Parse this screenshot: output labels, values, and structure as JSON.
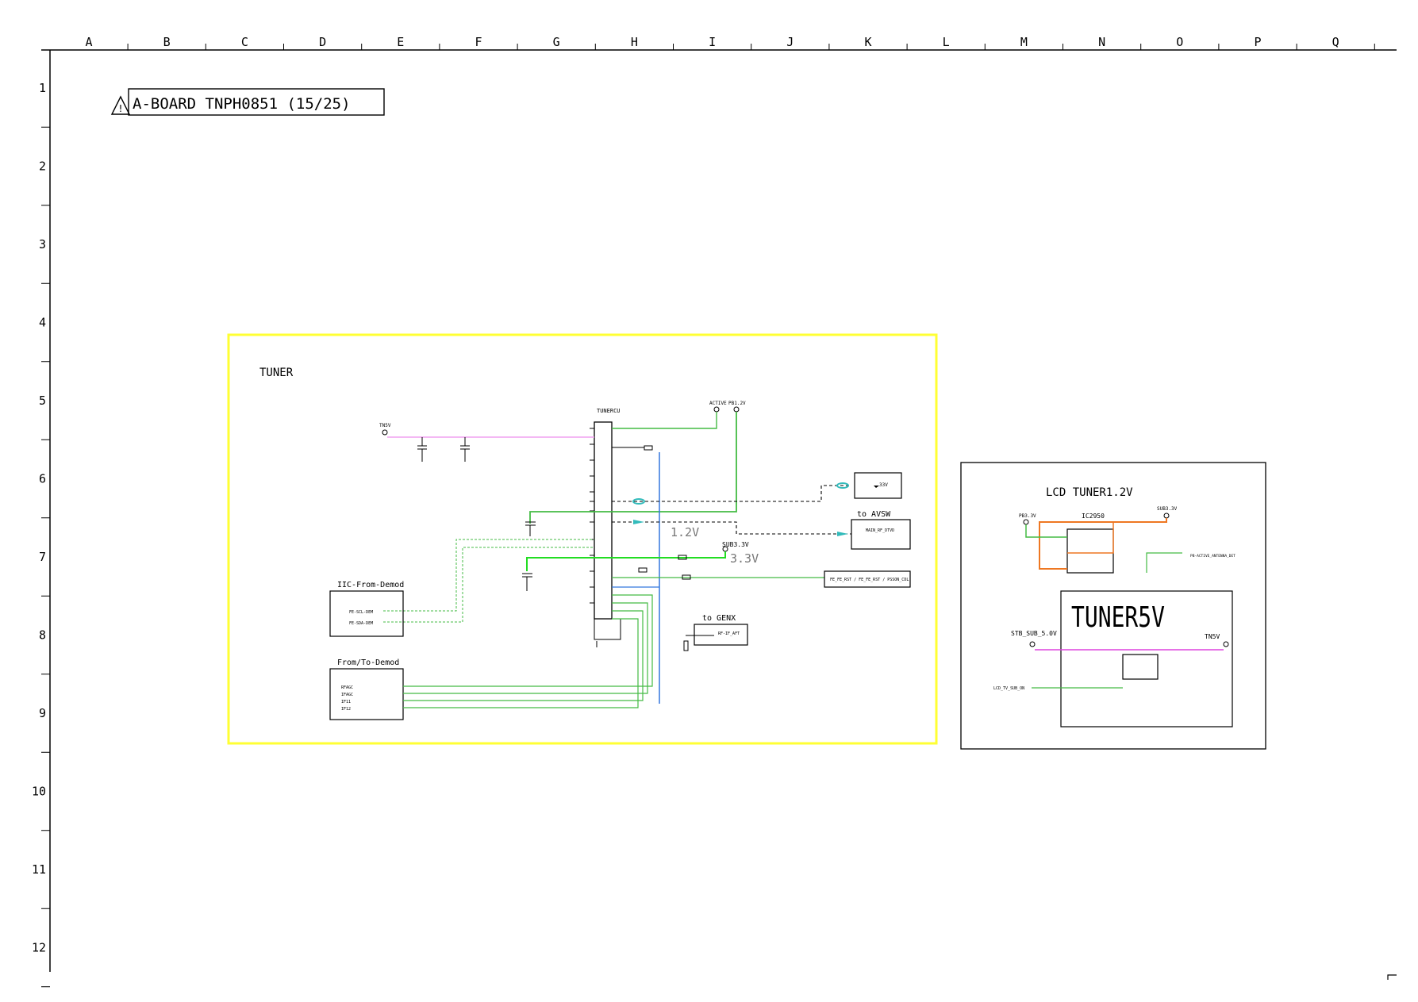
{
  "grid": {
    "columns": [
      "A",
      "B",
      "C",
      "D",
      "E",
      "F",
      "G",
      "H",
      "I",
      "J",
      "K",
      "L",
      "M",
      "N",
      "O",
      "P",
      "Q"
    ],
    "rows": [
      "1",
      "2",
      "3",
      "4",
      "5",
      "6",
      "7",
      "8",
      "9",
      "10",
      "11",
      "12"
    ]
  },
  "title": {
    "text": "A-BOARD TNPH0851 (15/25)",
    "warning_icon": "warning-triangle-icon"
  },
  "tuner_block": {
    "label": "TUNER",
    "border_color": "#ffff33",
    "voltage_1v2": "1.2V",
    "voltage_3v3": "3.3V",
    "sub33_label": "SUB3.3V",
    "active_label": "ACTIVE",
    "pb12_label": "PB1.2V",
    "tnv5_label": "TN5V",
    "i2c_box_title": "IIC-From-Demod",
    "i2c_signals": [
      "FE-SCL-DEM",
      "FE-SDA-DEM"
    ],
    "demod_box_title": "From/To-Demod",
    "demod_signals": [
      "RFAGC",
      "IFAGC",
      "IF11",
      "IF12"
    ],
    "to_avsw": "to  AVSW",
    "avsw_signal": "MAIN_RF_DTVD",
    "to_genx": "to  GENX",
    "genx_signal": "RF-IF_AFT",
    "ref_box": "33V",
    "fe_box": "FE_FE_RST / FE_FE_RST / PSSON_CDL",
    "tuner_part": "TUNERCU"
  },
  "lcd_tuner_block": {
    "title": "LCD TUNER1.2V",
    "ic": "IC2950",
    "pb33": "PB3.3V",
    "sub33": "SUB3.3V",
    "tuner5v": "TUNER5V",
    "stb_label": "STB_SUB_5.0V",
    "tn5v": "TN5V",
    "lcd_sig": "LCD_TV_SUB_ON",
    "active_ant": "PB-ACTIVE_ANTENNA_DET"
  },
  "colors": {
    "green": "#44bb44",
    "bright_green": "#22dd22",
    "pink": "#f0a0f0",
    "blue": "#3377dd",
    "orange": "#ee7722",
    "magenta": "#dd44dd",
    "teal": "#33bbbb"
  }
}
